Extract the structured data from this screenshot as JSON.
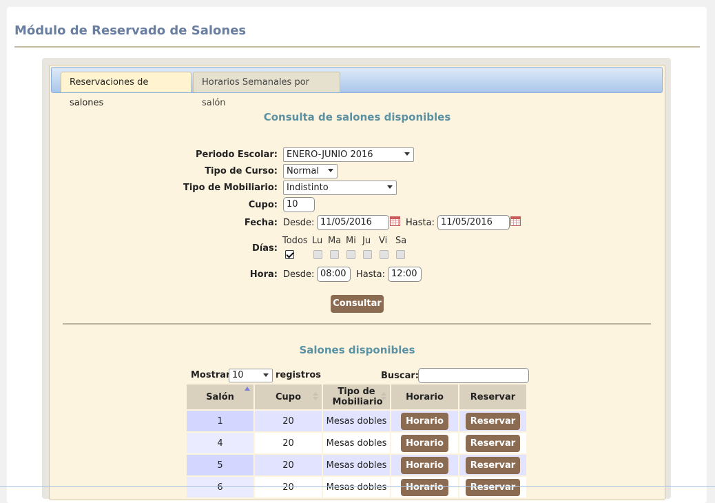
{
  "page": {
    "title": "Módulo de Reservado de Salones"
  },
  "tabs": [
    {
      "label": "Reservaciones de salones",
      "active": true
    },
    {
      "label": "Horarios Semanales por salón",
      "active": false
    }
  ],
  "form": {
    "heading": "Consulta de salones disponibles",
    "periodo": {
      "label": "Periodo Escolar:",
      "value": "ENERO-JUNIO 2016"
    },
    "tipo_curso": {
      "label": "Tipo de Curso:",
      "value": "Normal"
    },
    "tipo_mobiliario": {
      "label": "Tipo de Mobiliario:",
      "value": "Indistinto"
    },
    "cupo": {
      "label": "Cupo:",
      "value": "10"
    },
    "fecha": {
      "label": "Fecha:",
      "desde_label": "Desde:",
      "desde_value": "11/05/2016",
      "hasta_label": "Hasta:",
      "hasta_value": "11/05/2016"
    },
    "dias": {
      "label": "Días:",
      "items": [
        {
          "label": "Todos",
          "checked": true
        },
        {
          "label": "Lu",
          "checked": false
        },
        {
          "label": "Ma",
          "checked": false
        },
        {
          "label": "Mi",
          "checked": false
        },
        {
          "label": "Ju",
          "checked": false
        },
        {
          "label": "Vi",
          "checked": false
        },
        {
          "label": "Sa",
          "checked": false
        }
      ]
    },
    "hora": {
      "label": "Hora:",
      "desde_label": "Desde:",
      "desde_value": "08:00",
      "hasta_label": "Hasta:",
      "hasta_value": "12:00"
    },
    "submit_label": "Consultar"
  },
  "results": {
    "heading": "Salones disponibles",
    "mostrar_label": "Mostrar",
    "page_size": "10",
    "registros_label": "registros",
    "buscar_label": "Buscar:",
    "buscar_value": "",
    "columns": [
      "Salón",
      "Cupo",
      "Tipo de Mobiliario",
      "Horario",
      "Reservar"
    ],
    "rows": [
      {
        "salon": "1",
        "cupo": "20",
        "mobiliario": "Mesas dobles",
        "horario": "Horario",
        "reservar": "Reservar"
      },
      {
        "salon": "4",
        "cupo": "20",
        "mobiliario": "Mesas dobles",
        "horario": "Horario",
        "reservar": "Reservar"
      },
      {
        "salon": "5",
        "cupo": "20",
        "mobiliario": "Mesas dobles",
        "horario": "Horario",
        "reservar": "Reservar"
      },
      {
        "salon": "6",
        "cupo": "20",
        "mobiliario": "Mesas dobles",
        "horario": "Horario",
        "reservar": "Reservar"
      }
    ]
  },
  "colors": {
    "accent_brown": "#8b6c53",
    "title_blue": "#6a7fa0",
    "heading_teal": "#5b92a3",
    "panel_bg": "#fdf4df"
  }
}
